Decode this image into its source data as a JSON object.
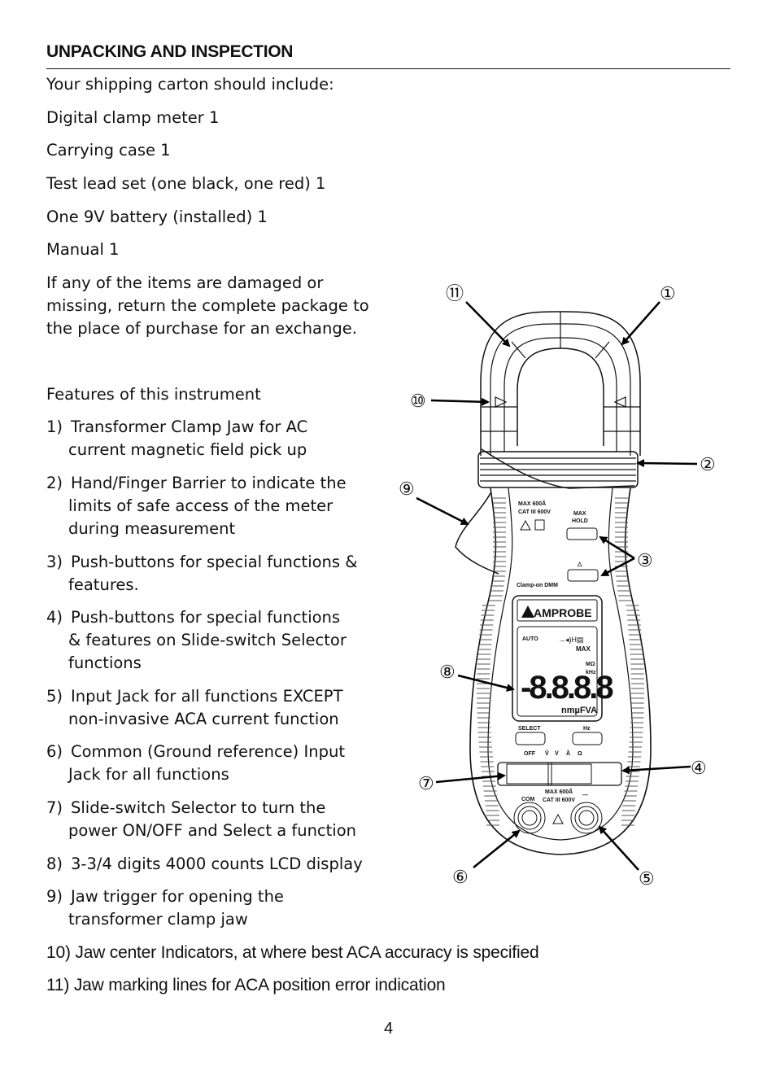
{
  "heading": "UNPACKING AND INSPECTION",
  "intro": "Your shipping carton should include:",
  "contents": [
    "Digital clamp meter 1",
    "Carrying case 1",
    "Test lead set (one black, one red) 1",
    "One 9V battery (installed) 1",
    "Manual 1"
  ],
  "damage_note": [
    "If any of the items are damaged or",
    "missing, return the complete package to",
    "the place of purchase for an exchange."
  ],
  "features_title": "Features of this instrument",
  "features": [
    {
      "num": "1)",
      "lines": [
        "Transformer Clamp Jaw for AC",
        "current magnetic field pick up"
      ]
    },
    {
      "num": "2)",
      "lines": [
        "Hand/Finger Barrier to indicate the",
        "limits of safe access of the meter",
        "during measurement"
      ]
    },
    {
      "num": "3)",
      "lines": [
        "Push-buttons for special functions &",
        "features."
      ]
    },
    {
      "num": "4)",
      "lines": [
        "Push-buttons for special functions",
        "& features on Slide-switch Selector",
        "functions"
      ]
    },
    {
      "num": "5)",
      "lines": [
        "Input Jack for all functions EXCEPT",
        "non-invasive ACA current function"
      ]
    },
    {
      "num": "6)",
      "lines": [
        "Common (Ground reference) Input",
        "Jack for all functions"
      ]
    },
    {
      "num": "7)",
      "lines": [
        "Slide-switch Selector to turn the",
        "power ON/OFF and Select a function"
      ]
    },
    {
      "num": "8)",
      "lines": [
        "3-3/4 digits 4000 counts LCD display"
      ]
    },
    {
      "num": "9)",
      "lines": [
        "Jaw trigger for opening the",
        "transformer clamp jaw"
      ]
    },
    {
      "num": "10)",
      "lines": [
        "Jaw center Indicators, at where best ACA accuracy is specified"
      ]
    },
    {
      "num": "11)",
      "lines": [
        "Jaw marking lines for ACA position error indication"
      ]
    }
  ],
  "page_number": "4",
  "diagram": {
    "callouts": [
      "①",
      "②",
      "③",
      "④",
      "⑤",
      "⑥",
      "⑦",
      "⑧",
      "⑨",
      "⑩",
      "⑪"
    ],
    "rating_top": [
      "MAX 600Ã",
      "CAT III 600V"
    ],
    "max_hold": [
      "MAX",
      "HOLD"
    ],
    "delta": "△",
    "model": "Clamp-on DMM",
    "brand": "AMPROBE",
    "lcd": {
      "auto": "AUTO",
      "digits": "-8.8.8.8",
      "units_right": [
        "MΩ",
        "kHz"
      ],
      "units_bottom": "nmµFVA",
      "max": "MAX"
    },
    "buttons": [
      "SELECT",
      "Hz"
    ],
    "switch_positions": [
      "OFF",
      "Ṽ",
      "V̅",
      "Ã",
      "Ω"
    ],
    "jack_labels": {
      "com": "COM",
      "rating": [
        "MAX 600Ã",
        "CAT III 600V"
      ],
      "minus": "—"
    }
  }
}
